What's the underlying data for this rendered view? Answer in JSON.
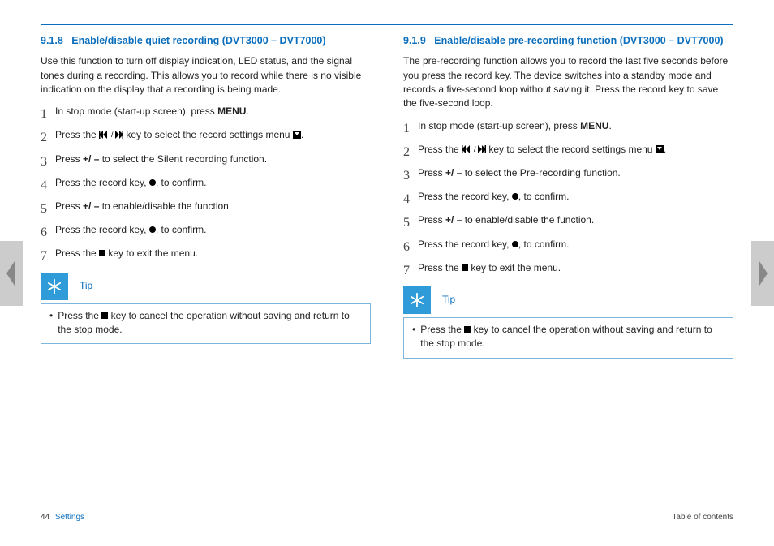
{
  "page_number": "44",
  "section_label": "Settings",
  "toc_label": "Table of contents",
  "tip_label": "Tip",
  "left": {
    "heading_no": "9.1.8",
    "heading_title": "Enable/disable quiet recording (DVT3000 – DVT7000)",
    "intro": "Use this function to turn off display indication, LED status, and the signal tones during a recording. This allows you to record while there is no visible indication on the display that a recording is being made.",
    "steps": {
      "s1a": "In stop mode (start-up screen), press ",
      "s1b": "MENU",
      "s1c": ".",
      "s2a": "Press the ",
      "s2b": " key to select the record settings menu ",
      "s2c": ".",
      "s3a": "Press ",
      "s3b": "+/ –",
      "s3c": " to select the ",
      "s3d": "Silent recording",
      "s3e": " function.",
      "s4a": "Press the record key, ",
      "s4b": ", to confirm.",
      "s5a": "Press ",
      "s5b": "+/ –",
      "s5c": " to enable/disable the function.",
      "s6a": "Press the record key, ",
      "s6b": ", to confirm.",
      "s7a": "Press the ",
      "s7b": " key to exit the menu."
    },
    "tip_a": "Press the ",
    "tip_b": " key to cancel the operation without saving and return to the stop mode."
  },
  "right": {
    "heading_no": "9.1.9",
    "heading_title": "Enable/disable pre-recording function (DVT3000 – DVT7000)",
    "intro": "The pre-recording function allows you to record the last five seconds before you press the record key. The device switches into a standby mode and records a five-second loop without saving it. Press the record key to save the five-second loop.",
    "steps": {
      "s1a": "In stop mode (start-up screen), press ",
      "s1b": "MENU",
      "s1c": ".",
      "s2a": "Press the ",
      "s2b": " key to select the record settings menu ",
      "s2c": ".",
      "s3a": "Press ",
      "s3b": "+/ –",
      "s3c": " to select the ",
      "s3d": "Pre-recording",
      "s3e": " function.",
      "s4a": "Press the record key, ",
      "s4b": ", to confirm.",
      "s5a": "Press ",
      "s5b": "+/ –",
      "s5c": " to enable/disable the function.",
      "s6a": "Press the record key, ",
      "s6b": ", to confirm.",
      "s7a": "Press the ",
      "s7b": " key to exit the menu."
    },
    "tip_a": "Press the ",
    "tip_b": " key to cancel the operation without saving and return to the stop mode."
  },
  "nums": {
    "n1": "1",
    "n2": "2",
    "n3": "3",
    "n4": "4",
    "n5": "5",
    "n6": "6",
    "n7": "7"
  }
}
